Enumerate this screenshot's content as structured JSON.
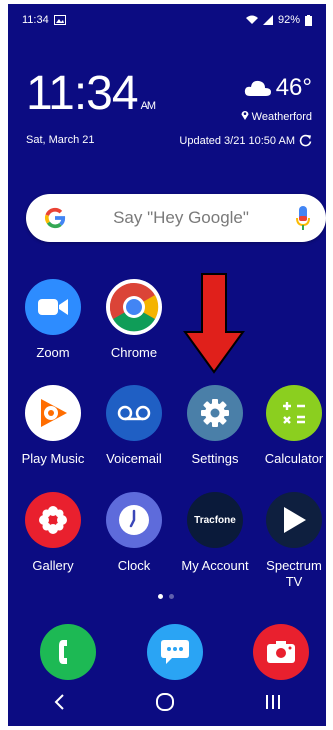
{
  "status_bar": {
    "time": "11:34",
    "battery": "92%"
  },
  "clock_widget": {
    "time": "11:34",
    "ampm": "AM",
    "date": "Sat, March 21"
  },
  "weather_widget": {
    "temperature": "46°",
    "location": "Weatherford",
    "updated": "Updated 3/21 10:50 AM"
  },
  "search_bar": {
    "placeholder": "Say \"Hey Google\""
  },
  "apps": {
    "zoom": "Zoom",
    "chrome": "Chrome",
    "play_music": "Play Music",
    "voicemail": "Voicemail",
    "settings": "Settings",
    "calculator": "Calculator",
    "gallery": "Gallery",
    "clock": "Clock",
    "my_account": "My Account",
    "spectrum_tv": "Spectrum TV"
  },
  "my_account_logo_text": "Tracfone",
  "colors": {
    "background": "#0c0c82",
    "annotation_arrow": "#e0201b"
  },
  "icons": [
    "image-icon",
    "cloud-icon",
    "wifi-icon",
    "signal-icon",
    "battery-icon",
    "location-pin-icon",
    "refresh-icon",
    "google-g-icon",
    "microphone-icon",
    "phone-icon",
    "messages-icon",
    "camera-icon",
    "back-icon",
    "home-icon",
    "recents-icon"
  ]
}
